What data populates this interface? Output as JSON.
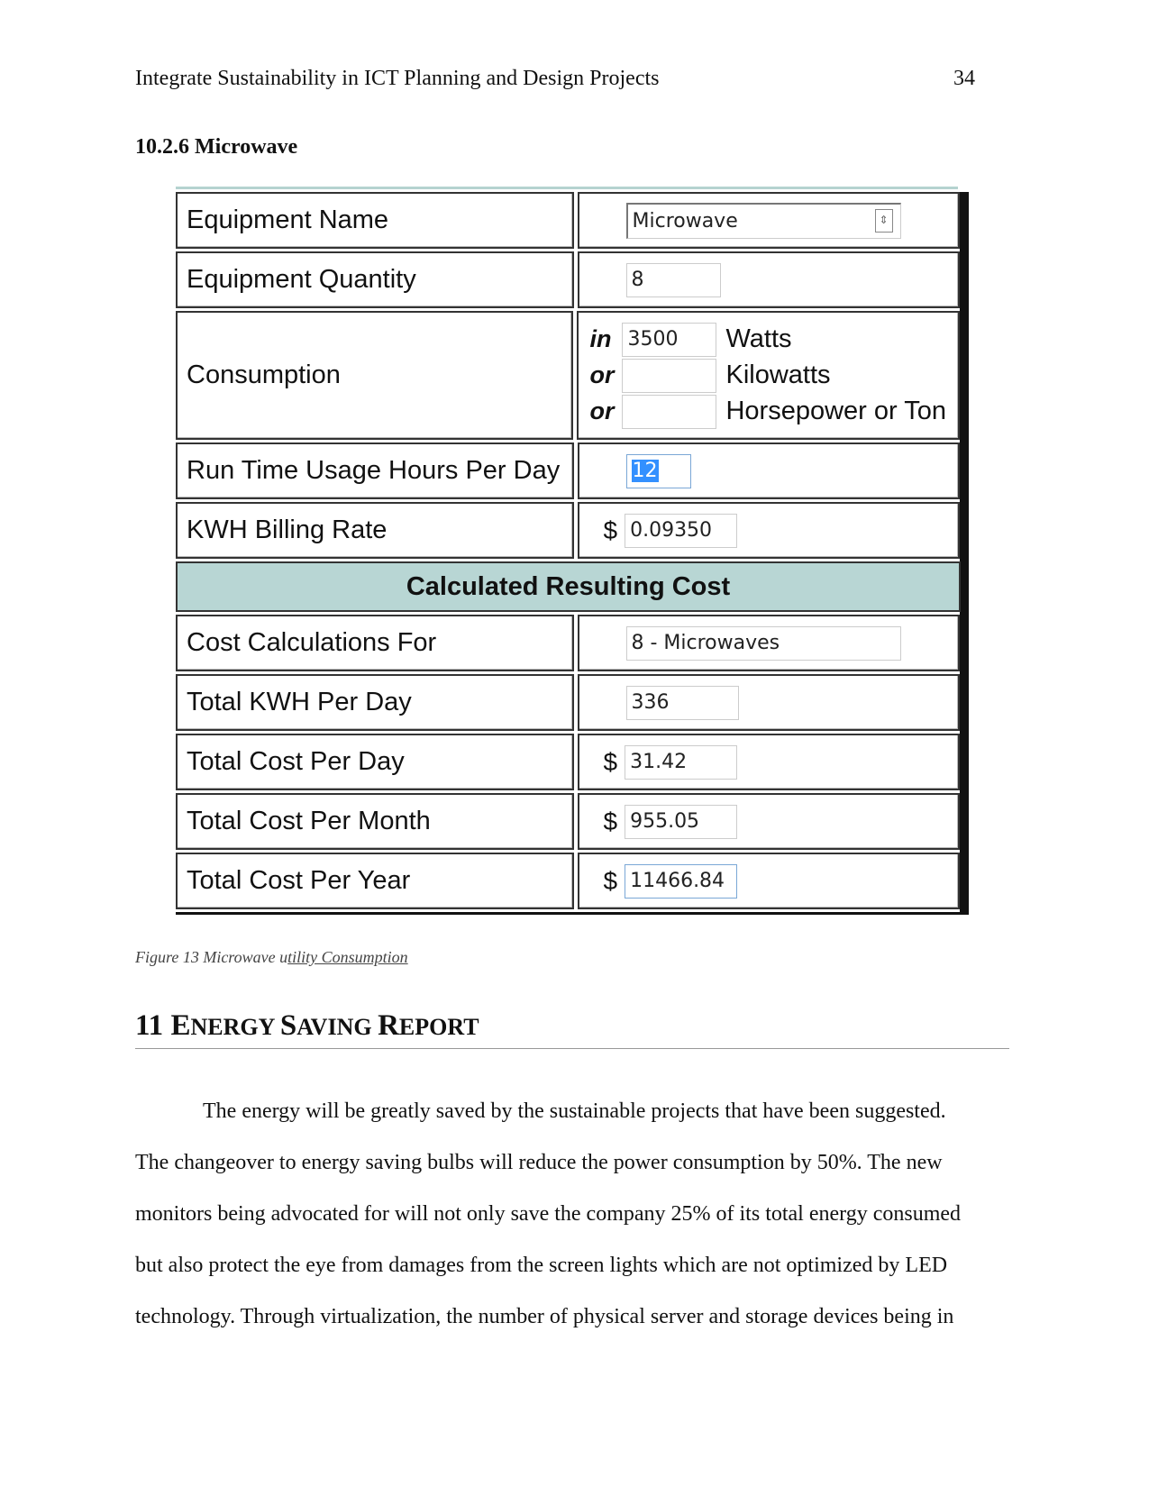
{
  "header": {
    "title": "Integrate Sustainability in ICT Planning and Design Projects",
    "page_number": "34"
  },
  "section": {
    "title": "10.2.6  Microwave"
  },
  "form": {
    "equipment_name_label": "Equipment Name",
    "equipment_name_value": "Microwave",
    "equipment_quantity_label": "Equipment Quantity",
    "equipment_quantity_value": "8",
    "consumption_label": "Consumption",
    "consumption": [
      {
        "prefix": "in",
        "value": "3500",
        "unit": "Watts"
      },
      {
        "prefix": "or",
        "value": "",
        "unit": "Kilowatts"
      },
      {
        "prefix": "or",
        "value": "",
        "unit": "Horsepower or Ton"
      }
    ],
    "run_time_label": "Run Time Usage Hours Per Day",
    "run_time_value": "12",
    "billing_rate_label": "KWH Billing Rate",
    "currency_symbol": "$",
    "billing_rate_value": "0.09350",
    "results_heading": "Calculated Resulting Cost",
    "cost_for_label": "Cost Calculations For",
    "cost_for_value": "8 - Microwaves",
    "kwh_per_day_label": "Total KWH Per Day",
    "kwh_per_day_value": "336",
    "cost_per_day_label": "Total Cost Per Day",
    "cost_per_day_value": "31.42",
    "cost_per_month_label": "Total Cost Per Month",
    "cost_per_month_value": "955.05",
    "cost_per_year_label": "Total Cost Per Year",
    "cost_per_year_value": "11466.84"
  },
  "caption": {
    "prefix": "Figure 13 Microwave u",
    "underlined": "tility Consumption"
  },
  "chapter": {
    "number": "11",
    "title_parts": [
      "E",
      "NERGY ",
      "S",
      "AVING ",
      "R",
      "EPORT"
    ]
  },
  "body_lines": [
    "The energy will be greatly saved by the sustainable projects that have been suggested.",
    "The changeover to energy saving bulbs will reduce the power consumption by 50%. The new",
    "monitors being advocated for will not only save the company 25% of its total energy consumed",
    "but also protect the eye from damages from the screen lights which are not optimized by LED",
    "technology. Through virtualization, the number of physical server and storage devices being in"
  ]
}
